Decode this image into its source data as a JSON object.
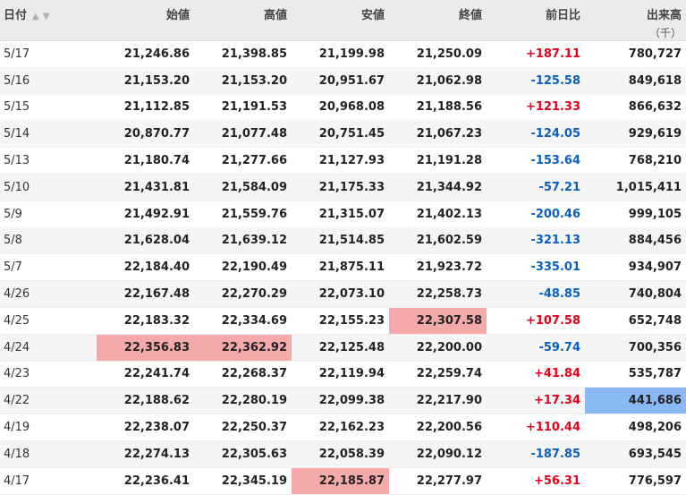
{
  "header": {
    "date": "日付",
    "open": "始値",
    "high": "高値",
    "low": "安値",
    "close": "終値",
    "change": "前日比",
    "volume": "出来高",
    "volume_unit": "（千）",
    "sort_icon": "▲▼"
  },
  "rows": [
    {
      "date": "5/17",
      "open": "21,246.86",
      "high": "21,398.85",
      "low": "21,199.98",
      "close": "21,250.09",
      "change": "+187.11",
      "volume": "780,727"
    },
    {
      "date": "5/16",
      "open": "21,153.20",
      "high": "21,153.20",
      "low": "20,951.67",
      "close": "21,062.98",
      "change": "-125.58",
      "volume": "849,618"
    },
    {
      "date": "5/15",
      "open": "21,112.85",
      "high": "21,191.53",
      "low": "20,968.08",
      "close": "21,188.56",
      "change": "+121.33",
      "volume": "866,632"
    },
    {
      "date": "5/14",
      "open": "20,870.77",
      "high": "21,077.48",
      "low": "20,751.45",
      "close": "21,067.23",
      "change": "-124.05",
      "volume": "929,619"
    },
    {
      "date": "5/13",
      "open": "21,180.74",
      "high": "21,277.66",
      "low": "21,127.93",
      "close": "21,191.28",
      "change": "-153.64",
      "volume": "768,210"
    },
    {
      "date": "5/10",
      "open": "21,431.81",
      "high": "21,584.09",
      "low": "21,175.33",
      "close": "21,344.92",
      "change": "-57.21",
      "volume": "1,015,411"
    },
    {
      "date": "5/9",
      "open": "21,492.91",
      "high": "21,559.76",
      "low": "21,315.07",
      "close": "21,402.13",
      "change": "-200.46",
      "volume": "999,105"
    },
    {
      "date": "5/8",
      "open": "21,628.04",
      "high": "21,639.12",
      "low": "21,514.85",
      "close": "21,602.59",
      "change": "-321.13",
      "volume": "884,456"
    },
    {
      "date": "5/7",
      "open": "22,184.40",
      "high": "22,190.49",
      "low": "21,875.11",
      "close": "21,923.72",
      "change": "-335.01",
      "volume": "934,907"
    },
    {
      "date": "4/26",
      "open": "22,167.48",
      "high": "22,270.29",
      "low": "22,073.10",
      "close": "22,258.73",
      "change": "-48.85",
      "volume": "740,804"
    },
    {
      "date": "4/25",
      "open": "22,183.32",
      "high": "22,334.69",
      "low": "22,155.23",
      "close": "22,307.58",
      "change": "+107.58",
      "volume": "652,748"
    },
    {
      "date": "4/24",
      "open": "22,356.83",
      "high": "22,362.92",
      "low": "22,125.48",
      "close": "22,200.00",
      "change": "-59.74",
      "volume": "700,356"
    },
    {
      "date": "4/23",
      "open": "22,241.74",
      "high": "22,268.37",
      "low": "22,119.94",
      "close": "22,259.74",
      "change": "+41.84",
      "volume": "535,787"
    },
    {
      "date": "4/22",
      "open": "22,188.62",
      "high": "22,280.19",
      "low": "22,099.38",
      "close": "22,217.90",
      "change": "+17.34",
      "volume": "441,686"
    },
    {
      "date": "4/19",
      "open": "22,238.07",
      "high": "22,250.37",
      "low": "22,162.23",
      "close": "22,200.56",
      "change": "+110.44",
      "volume": "498,206"
    },
    {
      "date": "4/18",
      "open": "22,274.13",
      "high": "22,305.63",
      "low": "22,058.39",
      "close": "22,090.12",
      "change": "-187.85",
      "volume": "693,545"
    },
    {
      "date": "4/17",
      "open": "22,236.41",
      "high": "22,345.19",
      "low": "22,185.87",
      "close": "22,277.97",
      "change": "+56.31",
      "volume": "776,597"
    }
  ],
  "highlights": [
    {
      "row": 10,
      "col": "close",
      "color": "#f4a9aa"
    },
    {
      "row": 11,
      "col": "open",
      "color": "#f4a9aa"
    },
    {
      "row": 11,
      "col": "high",
      "color": "#f4a9aa"
    },
    {
      "row": 13,
      "col": "volume",
      "color": "#8ab8f5"
    },
    {
      "row": 16,
      "col": "low",
      "color": "#f4a9aa"
    }
  ],
  "colors": {
    "positive": "#e0001a",
    "negative": "#0a5fbf",
    "header_bg": "#ebebeb",
    "highlight_high": "#f4a9aa",
    "highlight_low_volume": "#8ab8f5"
  }
}
